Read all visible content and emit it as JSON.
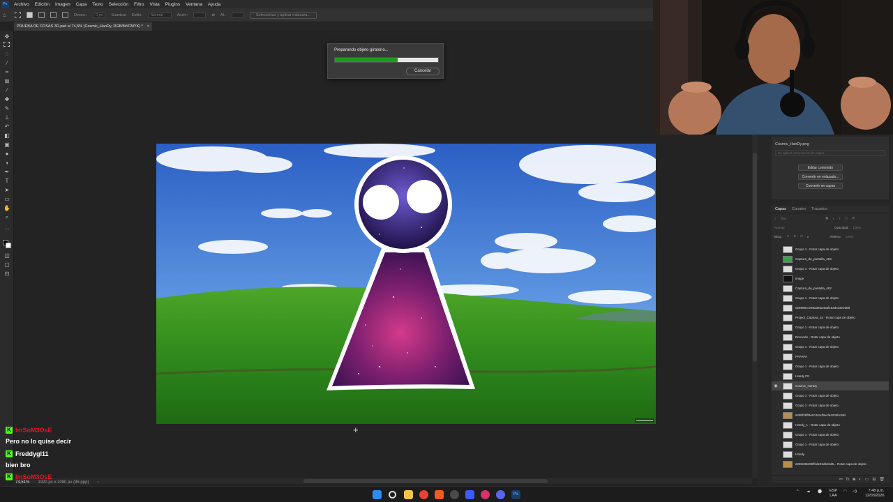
{
  "menubar": {
    "items": [
      "Archivo",
      "Edición",
      "Imagen",
      "Capa",
      "Texto",
      "Selección",
      "Filtro",
      "Vista",
      "Plugins",
      "Ventana",
      "Ayuda"
    ]
  },
  "options_bar": {
    "feather_label": "Desen.:",
    "feather_value": "0 px",
    "antialias_label": "Suavizar",
    "style_label": "Estilo:",
    "style_value": "Normal",
    "width_label": "Anch.:",
    "height_label": "Al.:",
    "select_mask_button": "Seleccionar y aplicar máscara..."
  },
  "document_tab": {
    "title": "PRUEBA DE COSAS 3D.psd al 74,5% (Cosmic_HanDy, RGB/8#/CMYK) *",
    "close": "×"
  },
  "progress_dialog": {
    "message": "Preparando objeto giratorio...",
    "progress": 0.61,
    "cancel_label": "Cancelar"
  },
  "status_bar": {
    "zoom": "74,51%",
    "doc_size": "1920 px x 1080 px (96 ppp)",
    "arrow": "›"
  },
  "properties_panel": {
    "title": "Cosmic_HanDy.png",
    "hint": "No aplicar composición de capas",
    "buttons": [
      "Editar contenido",
      "Convertir en enlazado...",
      "Convertir en capas"
    ]
  },
  "layers_panel": {
    "tabs": [
      "Capas",
      "Canales",
      "Trazados"
    ],
    "filter_label": "Tipo",
    "blend_mode": "Normal",
    "opacity_label": "Opacidad:",
    "opacity_value": "100%",
    "lock_label": "Bloq.:",
    "fill_label": "Relleno:",
    "fill_value": "100%",
    "layers": [
      {
        "name": "Grupo 1 - Rotar capa de objeto",
        "thumb": "white",
        "selected": false
      },
      {
        "name": "Captura_de_pantalla_463",
        "thumb": "green",
        "selected": false
      },
      {
        "name": "Grupo 1 - Rotar capa de objeto",
        "thumb": "white",
        "selected": false
      },
      {
        "name": "image",
        "thumb": "dark",
        "selected": false
      },
      {
        "name": "Captura_de_pantalla_462",
        "thumb": "white",
        "selected": false
      },
      {
        "name": "Grupo 1 - Rotar capa de objeto",
        "thumb": "white",
        "selected": false
      },
      {
        "name": "029898cce68a356a40af153dcd3eed89",
        "thumb": "white",
        "selected": false
      },
      {
        "name": "Project_Captura_34 - Rotar capa de objeto",
        "thumb": "white",
        "selected": false
      },
      {
        "name": "Grupo 1 - Rotar capa de objeto",
        "thumb": "white",
        "selected": false
      },
      {
        "name": "Devondo - Rotar capa de objeto",
        "thumb": "white",
        "selected": false
      },
      {
        "name": "Grupo 1 - Rotar capa de objeto",
        "thumb": "white",
        "selected": false
      },
      {
        "name": "PAPAPA",
        "thumb": "white",
        "selected": false
      },
      {
        "name": "Grupo 1 - Rotar capa de objeto",
        "thumb": "white",
        "selected": false
      },
      {
        "name": "Handy PE",
        "thumb": "white",
        "selected": false
      },
      {
        "name": "Cosmic_HanDy",
        "thumb": "white",
        "selected": true
      },
      {
        "name": "Grupo 1 - Rotar capa de objeto",
        "thumb": "white",
        "selected": false
      },
      {
        "name": "Grupo 1 - Rotar capa de objeto",
        "thumb": "white",
        "selected": false
      },
      {
        "name": "528bf2bff8e0c3c5cf9ecfe4233bc062",
        "thumb": "img",
        "selected": false
      },
      {
        "name": "Handy_1 - Rotar capa de objeto",
        "thumb": "white",
        "selected": false
      },
      {
        "name": "Grupo 1 - Rotar capa de objeto",
        "thumb": "white",
        "selected": false
      },
      {
        "name": "Grupo 1 - Rotar capa de objeto",
        "thumb": "white",
        "selected": false
      },
      {
        "name": "Handy",
        "thumb": "white",
        "selected": false
      },
      {
        "name": "2280e88e08ffede91dbd1d6... Rotar capa de objeto",
        "thumb": "img",
        "selected": false
      }
    ]
  },
  "chat": [
    {
      "user": "ImSoM3OsE",
      "user_color": "#e0162b",
      "message": "Pero no lo quise decir"
    },
    {
      "user": "FreddygI11",
      "user_color": "#ffffff",
      "message": "bien bro"
    },
    {
      "user": "ImSoM3OsE",
      "user_color": "#e0162b",
      "message": ""
    }
  ],
  "taskbar": {
    "language": "ESP",
    "language_sub": "LAA",
    "time": "7:48 p.m.",
    "date": "12/03/2026"
  },
  "colors": {
    "progress_fill": "#1e9b1e",
    "kick_green": "#53fc18",
    "ps_blue": "#31a8ff"
  }
}
